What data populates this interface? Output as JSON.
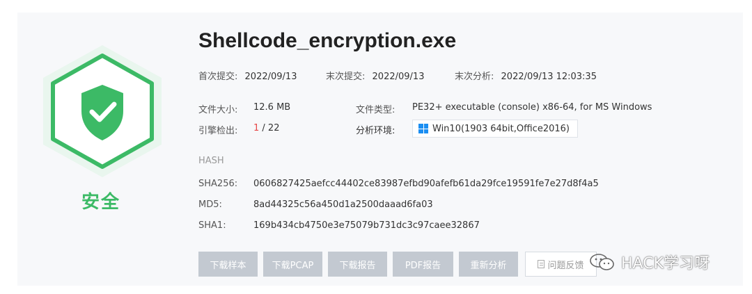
{
  "file": {
    "name": "Shellcode_encryption.exe",
    "verdict": "安全"
  },
  "dates": {
    "first_submit_label": "首次提交:",
    "first_submit_value": "2022/09/13",
    "last_submit_label": "末次提交:",
    "last_submit_value": "2022/09/13",
    "last_analysis_label": "末次分析:",
    "last_analysis_value": "2022/09/13 12:03:35"
  },
  "details": {
    "size_label": "文件大小:",
    "size_value": "12.6 MB",
    "type_label": "文件类型:",
    "type_value": "PE32+ executable (console) x86-64, for MS Windows",
    "detect_label": "引擎检出:",
    "detect_hits": "1",
    "detect_total": "/ 22",
    "env_label": "分析环境:",
    "env_value": "Win10(1903 64bit,Office2016)"
  },
  "hash": {
    "header": "HASH",
    "sha256_label": "SHA256:",
    "sha256_value": "0606827425aefcc44402ce83987efbd90afefb61da29fce19591fe7e27d8f4a5",
    "md5_label": "MD5:",
    "md5_value": "8ad44325c56a450d1a2500daaad6fa03",
    "sha1_label": "SHA1:",
    "sha1_value": "169b434cb4750e3e75079b731dc3c97caee32867"
  },
  "actions": {
    "download_sample": "下载样本",
    "download_pcap": "下载PCAP",
    "download_report": "下载报告",
    "pdf_report": "PDF报告",
    "reanalyze": "重新分析",
    "feedback": "问题反馈"
  },
  "watermark": "HACK学习呀",
  "colors": {
    "safe_green": "#3cba66",
    "detect_red": "#e64545",
    "button_gray": "#c3c9d1",
    "windows_blue": "#1b8ef2"
  },
  "icons": [
    "shield-check-icon",
    "windows-icon",
    "document-icon",
    "wechat-logo-icon"
  ]
}
